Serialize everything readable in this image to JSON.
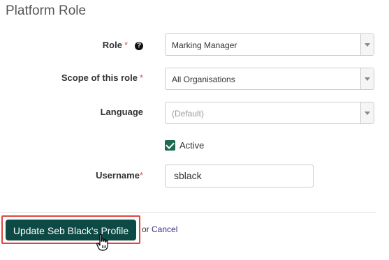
{
  "section": {
    "title": "Platform Role"
  },
  "fields": {
    "role": {
      "label": "Role",
      "required_marker": "*",
      "help_icon": "question-circle-icon",
      "value": "Marking Manager"
    },
    "scope": {
      "label": "Scope of this role",
      "required_marker": "*",
      "value": "All Organisations"
    },
    "language": {
      "label": "Language",
      "value": "(Default)"
    },
    "active": {
      "label": "Active",
      "checked": true
    },
    "username": {
      "label": "Username",
      "required_marker": "*",
      "value": "sblack"
    }
  },
  "actions": {
    "primary_label": "Update Seb Black's Profile",
    "or_text": "or",
    "cancel_label": "Cancel"
  },
  "colors": {
    "primary_button": "#0d4a45",
    "checkbox": "#1e6b52",
    "required": "#d9534f",
    "highlight_border": "#e0463f",
    "link": "#3f2a8c"
  },
  "icons": {
    "dropdown": "chevron-down-icon",
    "cursor": "hand-pointer-icon",
    "checkbox": "check-icon"
  }
}
